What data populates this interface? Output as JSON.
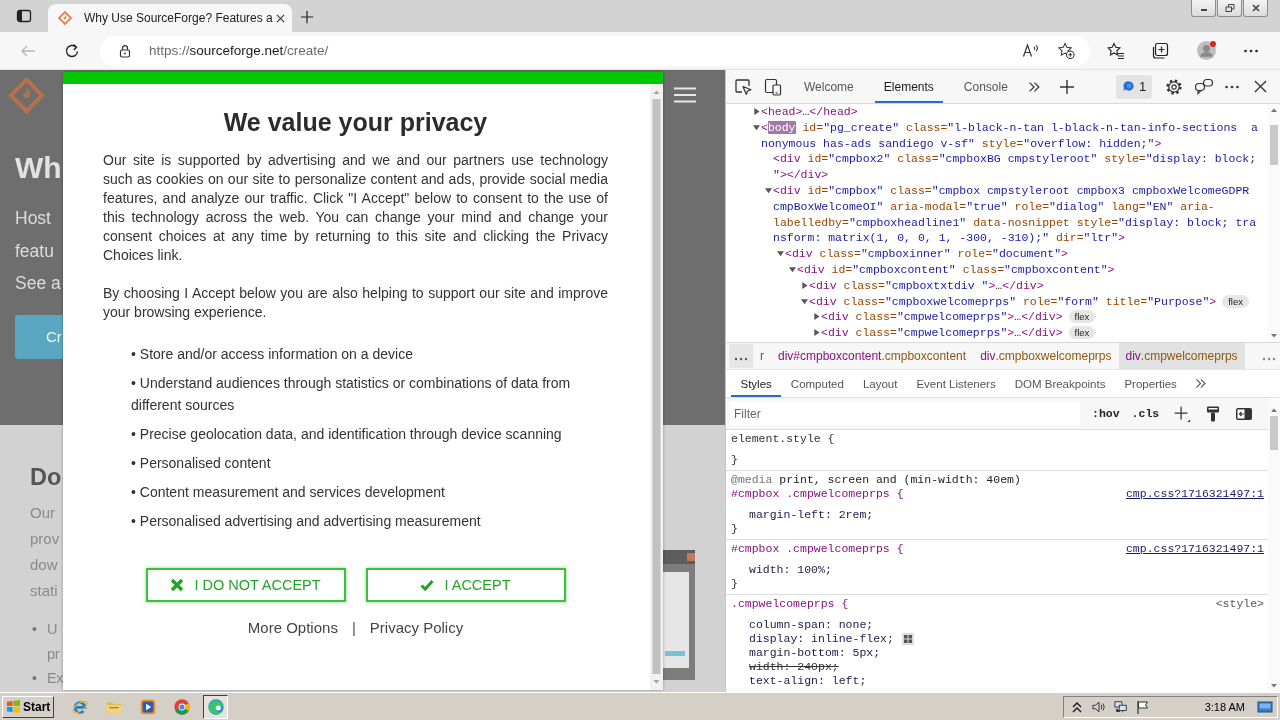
{
  "browser": {
    "tab": {
      "title": "Why Use SourceForge? Features a"
    },
    "back": {
      "disabled": true
    },
    "url": {
      "scheme": "https://",
      "host": "sourceforge.net",
      "path": "/create/"
    }
  },
  "page": {
    "hero": {
      "title": "Wh",
      "lines": [
        "Host",
        "featu",
        "See a"
      ],
      "button": "Cr"
    },
    "section": {
      "title": "Do",
      "lines": [
        "Our",
        "prov",
        "dow",
        "stati"
      ],
      "list": [
        {
          "marker": "•",
          "lines": [
            "U",
            "pr"
          ]
        },
        {
          "marker": "•",
          "lines": [
            "Ex"
          ]
        }
      ]
    }
  },
  "consent": {
    "title": "We value your privacy",
    "paragraphs": [
      "Our site is supported by advertising and we and our partners use technology such as cookies on our site to personalize content and ads, provide social media features, and analyze our traffic. Click \"I Accept\" below to consent to the use of this technology across the web. You can change your mind and change your consent choices at any time by returning to this site and clicking the Privacy Choices link.",
      "By choosing I Accept below you are also helping to support our site and improve your browsing experience."
    ],
    "purposes": [
      "• Store and/or access information on a device",
      "• Understand audiences through statistics or combinations of data from different sources",
      "• Precise geolocation data, and identification through device scanning",
      "• Personalised content",
      "• Content measurement and services development",
      "• Personalised advertising and advertising measurement"
    ],
    "buttons": [
      {
        "kind": "reject",
        "label": "I DO NOT ACCEPT"
      },
      {
        "kind": "accept",
        "label": "I ACCEPT"
      }
    ],
    "links": [
      "More Options",
      "Privacy Policy"
    ],
    "separator": "|"
  },
  "devtools": {
    "tabs": [
      {
        "label": "Welcome",
        "selected": false
      },
      {
        "label": "Elements",
        "selected": true
      },
      {
        "label": "Console",
        "selected": false
      }
    ],
    "issues": "1",
    "dom_tree": [
      {
        "expanded": false,
        "lines": [
          [
            {
              "kind": "tag",
              "text": "<head>"
            },
            {
              "kind": "text",
              "text": "…"
            },
            {
              "kind": "tag",
              "text": "</head>"
            }
          ]
        ]
      },
      {
        "expanded": true,
        "lines": [
          [
            {
              "kind": "tag",
              "text": "<"
            },
            {
              "kind": "highlight",
              "text": "body"
            },
            {
              "kind": "attr",
              "text": " id="
            },
            {
              "kind": "value",
              "text": "\"pg_create\""
            },
            {
              "kind": "attr",
              "text": " class="
            },
            {
              "kind": "value",
              "text": "\"l-black-n-tan l-black-n-tan-info-sections  a"
            }
          ],
          [
            {
              "kind": "value",
              "text": "nonymous has-ads sandiego v-sf\""
            },
            {
              "kind": "attr",
              "text": " style="
            },
            {
              "kind": "value",
              "text": "\"overflow: hidden;\""
            },
            {
              "kind": "tag",
              "text": ">"
            }
          ]
        ],
        "children": [
          {
            "lines": [
              [
                {
                  "kind": "tag",
                  "text": "<div"
                },
                {
                  "kind": "attr",
                  "text": " id="
                },
                {
                  "kind": "value",
                  "text": "\"cmpbox2\""
                },
                {
                  "kind": "attr",
                  "text": " class="
                },
                {
                  "kind": "value",
                  "text": "\"cmpboxBG cmpstyleroot\""
                },
                {
                  "kind": "attr",
                  "text": " style="
                },
                {
                  "kind": "value",
                  "text": "\"display: block;"
                }
              ],
              [
                {
                  "kind": "value",
                  "text": "\""
                },
                {
                  "kind": "tag",
                  "text": "></div>"
                }
              ]
            ]
          },
          {
            "expanded": true,
            "lines": [
              [
                {
                  "kind": "tag",
                  "text": "<div"
                },
                {
                  "kind": "attr",
                  "text": " id="
                },
                {
                  "kind": "value",
                  "text": "\"cmpbox\""
                },
                {
                  "kind": "attr",
                  "text": " class="
                },
                {
                  "kind": "value",
                  "text": "\"cmpbox cmpstyleroot cmpbox3 cmpboxWelcomeGDPR"
                }
              ],
              [
                {
                  "kind": "value",
                  "text": "cmpBoxWelcomeOI\""
                },
                {
                  "kind": "attr",
                  "text": " aria-modal="
                },
                {
                  "kind": "value",
                  "text": "\"true\""
                },
                {
                  "kind": "attr",
                  "text": " role="
                },
                {
                  "kind": "value",
                  "text": "\"dialog\""
                },
                {
                  "kind": "attr",
                  "text": " lang="
                },
                {
                  "kind": "value",
                  "text": "\"EN\""
                },
                {
                  "kind": "attr",
                  "text": " aria-"
                }
              ],
              [
                {
                  "kind": "attr",
                  "text": "labelledby="
                },
                {
                  "kind": "value",
                  "text": "\"cmpboxheadline1\""
                },
                {
                  "kind": "attr",
                  "text": " data-nosnippet style="
                },
                {
                  "kind": "value",
                  "text": "\"display: block; tra"
                }
              ],
              [
                {
                  "kind": "value",
                  "text": "nsform: matrix(1, 0, 0, 1, -300, -310);\""
                },
                {
                  "kind": "attr",
                  "text": " dir="
                },
                {
                  "kind": "value",
                  "text": "\"ltr\""
                },
                {
                  "kind": "tag",
                  "text": ">"
                }
              ]
            ],
            "children": [
              {
                "expanded": true,
                "lines": [
                  [
                    {
                      "kind": "tag",
                      "text": "<div"
                    },
                    {
                      "kind": "attr",
                      "text": " class="
                    },
                    {
                      "kind": "value",
                      "text": "\"cmpboxinner\""
                    },
                    {
                      "kind": "attr",
                      "text": " role="
                    },
                    {
                      "kind": "value",
                      "text": "\"document\""
                    },
                    {
                      "kind": "tag",
                      "text": ">"
                    }
                  ]
                ],
                "children": [
                  {
                    "expanded": true,
                    "lines": [
                      [
                        {
                          "kind": "tag",
                          "text": "<div"
                        },
                        {
                          "kind": "attr",
                          "text": " id="
                        },
                        {
                          "kind": "value",
                          "text": "\"cmpboxcontent\""
                        },
                        {
                          "kind": "attr",
                          "text": " class="
                        },
                        {
                          "kind": "value",
                          "text": "\"cmpboxcontent\""
                        },
                        {
                          "kind": "tag",
                          "text": ">"
                        }
                      ]
                    ],
                    "children": [
                      {
                        "expanded": false,
                        "lines": [
                          [
                            {
                              "kind": "tag",
                              "text": "<div"
                            },
                            {
                              "kind": "attr",
                              "text": " class="
                            },
                            {
                              "kind": "value",
                              "text": "\"cmpboxtxtdiv \""
                            },
                            {
                              "kind": "tag",
                              "text": ">"
                            },
                            {
                              "kind": "text",
                              "text": "…"
                            },
                            {
                              "kind": "tag",
                              "text": "</div>"
                            }
                          ]
                        ]
                      },
                      {
                        "expanded": true,
                        "badge": "flex",
                        "lines": [
                          [
                            {
                              "kind": "tag",
                              "text": "<div"
                            },
                            {
                              "kind": "attr",
                              "text": " class="
                            },
                            {
                              "kind": "value",
                              "text": "\"cmpboxwelcomeprps\""
                            },
                            {
                              "kind": "attr",
                              "text": " role="
                            },
                            {
                              "kind": "value",
                              "text": "\"form\""
                            },
                            {
                              "kind": "attr",
                              "text": " title="
                            },
                            {
                              "kind": "value",
                              "text": "\"Purpose\""
                            },
                            {
                              "kind": "tag",
                              "text": ">"
                            }
                          ]
                        ],
                        "children": [
                          {
                            "expanded": false,
                            "badge": "flex",
                            "lines": [
                              [
                                {
                                  "kind": "tag",
                                  "text": "<div"
                                },
                                {
                                  "kind": "attr",
                                  "text": " class="
                                },
                                {
                                  "kind": "value",
                                  "text": "\"cmpwelcomeprps\""
                                },
                                {
                                  "kind": "tag",
                                  "text": ">"
                                },
                                {
                                  "kind": "text",
                                  "text": "…"
                                },
                                {
                                  "kind": "tag",
                                  "text": "</div>"
                                }
                              ]
                            ]
                          },
                          {
                            "expanded": false,
                            "badge": "flex",
                            "lines": [
                              [
                                {
                                  "kind": "tag",
                                  "text": "<div"
                                },
                                {
                                  "kind": "attr",
                                  "text": " class="
                                },
                                {
                                  "kind": "value",
                                  "text": "\"cmpwelcomeprps\""
                                },
                                {
                                  "kind": "tag",
                                  "text": ">"
                                },
                                {
                                  "kind": "text",
                                  "text": "…"
                                },
                                {
                                  "kind": "tag",
                                  "text": "</div>"
                                }
                              ]
                            ]
                          }
                        ]
                      }
                    ]
                  }
                ]
              }
            ]
          }
        ]
      }
    ],
    "breadcrumbs": [
      {
        "parts": [
          {
            "kind": "class",
            "text": "r"
          }
        ],
        "selected": false
      },
      {
        "parts": [
          {
            "kind": "tag",
            "text": "div"
          },
          {
            "kind": "id",
            "text": "#cmpboxcontent"
          },
          {
            "kind": "class",
            "text": ".cmpboxcontent"
          }
        ],
        "selected": false
      },
      {
        "parts": [
          {
            "kind": "tag",
            "text": "div"
          },
          {
            "kind": "class",
            "text": ".cmpboxwelcomeprps"
          }
        ],
        "selected": false
      },
      {
        "parts": [
          {
            "kind": "tag",
            "text": "div"
          },
          {
            "kind": "class",
            "text": ".cmpwelcomeprps"
          }
        ],
        "selected": true
      }
    ],
    "styles_tabs": [
      {
        "label": "Styles",
        "selected": true
      },
      {
        "label": "Computed",
        "selected": false
      },
      {
        "label": "Layout",
        "selected": false
      },
      {
        "label": "Event Listeners",
        "selected": false
      },
      {
        "label": "DOM Breakpoints",
        "selected": false
      },
      {
        "label": "Properties",
        "selected": false
      }
    ],
    "filter": {
      "placeholder": "Filter"
    },
    "filter_buttons": [
      ":hov",
      ".cls"
    ],
    "rules": [
      {
        "kind": "inline",
        "selector": "element.style {",
        "close": "}"
      },
      {
        "kind": "rule",
        "media": {
          "keyword": "@media",
          "query": "print, screen and (min-width: 40em)"
        },
        "selector": "#cmpbox .cmpwelcomeprps {",
        "source": {
          "kind": "link",
          "text": "cmp.css?1716321497:1"
        },
        "declarations": [
          {
            "text": "margin-left: 2rem;",
            "overridden": false
          }
        ],
        "close": "}"
      },
      {
        "kind": "rule",
        "selector": "#cmpbox .cmpwelcomeprps {",
        "source": {
          "kind": "link",
          "text": "cmp.css?1716321497:1"
        },
        "declarations": [
          {
            "text": "width: 100%;",
            "overridden": false
          }
        ],
        "close": "}"
      },
      {
        "kind": "rule",
        "selector": ".cmpwelcomeprps {",
        "source": {
          "kind": "inline",
          "text": "<style>"
        },
        "declarations": [
          {
            "text": "column-span: none;",
            "overridden": false
          },
          {
            "text": "display: inline-flex;",
            "overridden": false,
            "editor_button": true
          },
          {
            "text": "margin-bottom: 5px;",
            "overridden": false
          },
          {
            "text": "width: 240px;",
            "overridden": true
          },
          {
            "text": "text-align: left;",
            "overridden": false
          }
        ]
      }
    ]
  },
  "taskbar": {
    "start": "Start",
    "apps": [
      {
        "kind": "ie",
        "selected": false
      },
      {
        "kind": "explorer",
        "selected": false
      },
      {
        "kind": "media",
        "selected": false
      },
      {
        "kind": "chrome",
        "selected": false
      },
      {
        "kind": "edge",
        "selected": true
      }
    ],
    "clock": "3:18 AM"
  }
}
